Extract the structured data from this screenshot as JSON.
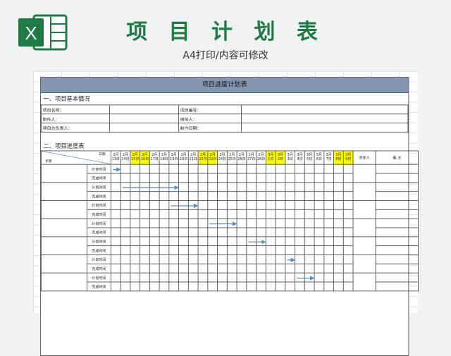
{
  "header": {
    "title": "项 目 计 划 表",
    "subtitle": "A4打印/内容可修改",
    "logo_icon": "excel-icon",
    "logo_letter": "X"
  },
  "document": {
    "title": "项目进度计划表",
    "section1": "一、项目基本情况",
    "section2": "二、项目进度表",
    "info_labels": {
      "name": "项目名称：",
      "number": "项目编号：",
      "maker": "制作人：",
      "reviewer": "审核人：",
      "leader": "项目总负责人：",
      "date": "制作日期："
    },
    "corner_date": "日期",
    "corner_step": "步骤",
    "dates": [
      "2月13日",
      "2月14日",
      "2月15日",
      "2月16日",
      "2月17日",
      "2月18日",
      "2月19日",
      "2月20日",
      "2月21日",
      "2月22日",
      "2月23日",
      "2月24日",
      "2月25日",
      "2月26日",
      "2月27日",
      "2月28日",
      "3月1日",
      "3月2日",
      "3月3日",
      "3月4日",
      "3月5日",
      "3月6日",
      "3月7日",
      "3月8日",
      "3月9日"
    ],
    "highlighted_dates": [
      "2月15日",
      "2月16日",
      "2月22日",
      "2月23日",
      "3月1日",
      "3月2日",
      "3月8日",
      "3月9日"
    ],
    "owner_label": "责任人",
    "note_label": "备  注",
    "plan_label": "计划时间",
    "actual_label": "完成时间",
    "arrow_color": "#5b8ac6",
    "highlight_color": "#ffff00",
    "title_bar_color": "#8496b0",
    "tasks": [
      {
        "plan_start": "2月13日",
        "plan_end": "2月13日"
      },
      {
        "plan_start": "2月14日",
        "plan_end": "2月19日"
      },
      {
        "plan_start": "2月19日",
        "plan_end": "2月21日"
      },
      {
        "plan_start": "2月23日",
        "plan_end": "2月25日"
      },
      {
        "plan_start": "2月27日",
        "plan_end": "2月28日"
      },
      {
        "plan_start": "3月3日",
        "plan_end": "3月3日"
      },
      {
        "plan_start": "3月4日",
        "plan_end": "3月5日"
      }
    ]
  }
}
